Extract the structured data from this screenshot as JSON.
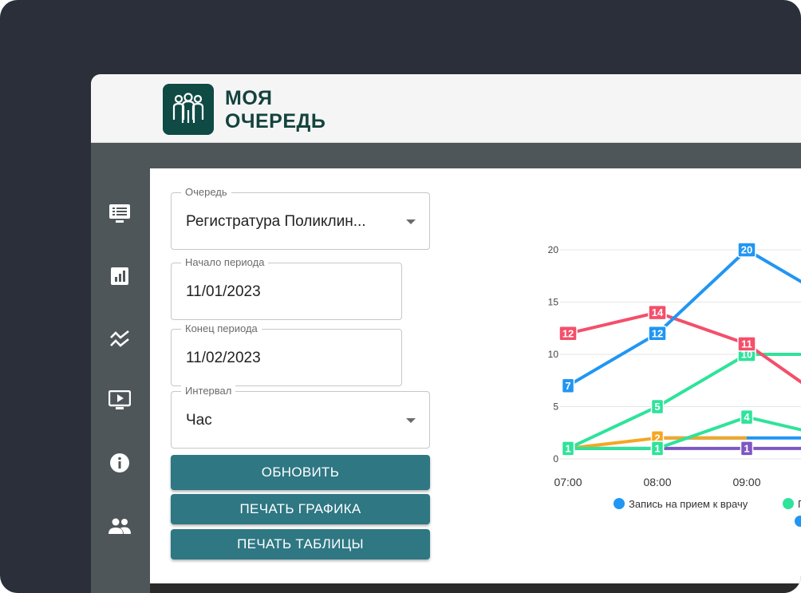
{
  "app": {
    "logo_line1": "МОЯ",
    "logo_line2": "ОЧЕРЕДЬ",
    "brand_color": "#0f4a45"
  },
  "sidebar": {
    "items": [
      {
        "icon": "monitor-list-icon"
      },
      {
        "icon": "bar-chart-icon"
      },
      {
        "icon": "trend-lines-icon"
      },
      {
        "icon": "play-screen-icon"
      },
      {
        "icon": "info-icon"
      },
      {
        "icon": "people-icon"
      }
    ]
  },
  "form": {
    "queue": {
      "label": "Очередь",
      "value": "Регистратура Поликлин..."
    },
    "start": {
      "label": "Начало периода",
      "value": "11/01/2023"
    },
    "end": {
      "label": "Конец периода",
      "value": "11/02/2023"
    },
    "interval": {
      "label": "Интервал",
      "value": "Час"
    },
    "refresh_label": "ОБНОВИТЬ",
    "print_chart_label": "ПЕЧАТЬ ГРАФИКА",
    "print_table_label": "ПЕЧАТЬ ТАБЛИЦЫ",
    "button_color": "#2e7783"
  },
  "chart_data": {
    "type": "line",
    "categories": [
      "07:00",
      "08:00",
      "09:00"
    ],
    "y_ticks": [
      0,
      5,
      10,
      15,
      20
    ],
    "ylim": [
      0,
      20
    ],
    "grid": true,
    "series": [
      {
        "name": "Запись на прием к врачу",
        "color": "#2196f3",
        "values": [
          7,
          12,
          20
        ]
      },
      {
        "name": "",
        "color": "#f44f6a",
        "values": [
          12,
          14,
          11
        ]
      },
      {
        "name": "П",
        "color": "#2ee39a",
        "values": [
          1,
          5,
          10
        ]
      },
      {
        "name": "",
        "color": "#2ee39a",
        "values": [
          1,
          1,
          4
        ]
      },
      {
        "name": "",
        "color": "#f5a623",
        "values": [
          1,
          2,
          null
        ]
      },
      {
        "name": "",
        "color": "#2196f3",
        "values": [
          null,
          null,
          null
        ]
      },
      {
        "name": "",
        "color": "#7e57c2",
        "values": [
          1,
          1,
          1
        ]
      }
    ],
    "continuation": [
      {
        "series": 0,
        "to": 15
      },
      {
        "series": 1,
        "to": 5
      },
      {
        "series": 2,
        "to": 10
      },
      {
        "series": 3,
        "to": 2
      },
      {
        "series": 4,
        "to": 2
      }
    ],
    "flat_line": {
      "color": "#2196f3",
      "value": 2,
      "from": "08:00"
    },
    "legend": [
      {
        "label": "Запись на прием к врачу",
        "color": "#2196f3"
      },
      {
        "label": "П",
        "color": "#2ee39a"
      }
    ]
  }
}
